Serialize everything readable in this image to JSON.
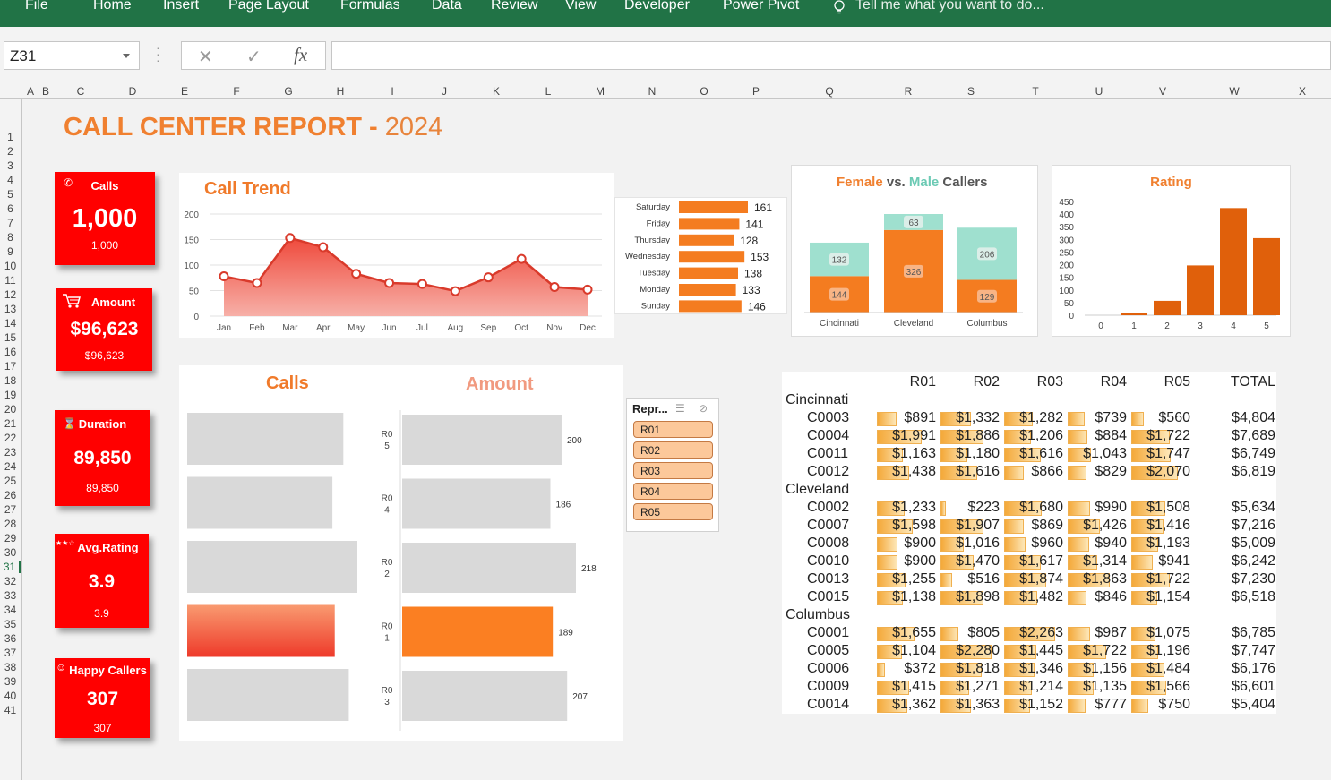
{
  "ribbon": {
    "tabs": [
      "File",
      "Home",
      "Insert",
      "Page Layout",
      "Formulas",
      "Data",
      "Review",
      "View",
      "Developer",
      "Power Pivot"
    ],
    "tell_me": "Tell me what you want to do..."
  },
  "formula_bar": {
    "name_box": "Z31",
    "fx": "fx",
    "cancel": "✕",
    "enter": "✓",
    "formula": ""
  },
  "columns": [
    "A",
    "B",
    "C",
    "D",
    "E",
    "F",
    "G",
    "H",
    "I",
    "J",
    "K",
    "L",
    "M",
    "N",
    "O",
    "P",
    "Q",
    "R",
    "S",
    "T",
    "U",
    "V",
    "W",
    "X"
  ],
  "rows": [
    "1",
    "2",
    "3",
    "4",
    "5",
    "6",
    "7",
    "8",
    "9",
    "10",
    "11",
    "12",
    "13",
    "14",
    "15",
    "16",
    "17",
    "18",
    "19",
    "20",
    "21",
    "22",
    "23",
    "24",
    "25",
    "26",
    "27",
    "28",
    "29",
    "30",
    "31",
    "32",
    "33",
    "34",
    "35",
    "36",
    "37",
    "38",
    "39",
    "40",
    "41"
  ],
  "report": {
    "title": "CALL CENTER REPORT - ",
    "year": "2024"
  },
  "kpis": [
    {
      "label": "Calls",
      "value": "1,000",
      "sub": "1,000",
      "icon": "phone-icon"
    },
    {
      "label": "Amount",
      "value": "$96,623",
      "sub": "$96,623",
      "icon": "cart-icon"
    },
    {
      "label": "Duration",
      "value": "89,850",
      "sub": "89,850",
      "icon": "hourglass-icon"
    },
    {
      "label": "Avg.Rating",
      "value": "3.9",
      "sub": "3.9",
      "icon": "stars-icon"
    },
    {
      "label": "Happy Callers",
      "value": "307",
      "sub": "307",
      "icon": "smiley-icon"
    }
  ],
  "colors": {
    "accent": "#f08030",
    "kpi_red": "#ff0000",
    "teal": "#9fe0cf",
    "ribbon": "#217346",
    "rating_bar": "#e0600b"
  },
  "trend_chart": {
    "title": "Call Trend",
    "chart_data": {
      "type": "area",
      "categories": [
        "Jan",
        "Feb",
        "Mar",
        "Apr",
        "May",
        "Jun",
        "Jul",
        "Aug",
        "Sep",
        "Oct",
        "Nov",
        "Dec"
      ],
      "values": [
        78,
        65,
        153,
        135,
        83,
        65,
        63,
        49,
        76,
        112,
        57,
        52
      ],
      "ylim": [
        0,
        200
      ],
      "yticks": [
        0,
        50,
        100,
        150,
        200
      ]
    }
  },
  "weekday_chart": {
    "chart_data": {
      "type": "bar",
      "categories": [
        "Saturday",
        "Friday",
        "Thursday",
        "Wednesday",
        "Tuesday",
        "Monday",
        "Sunday"
      ],
      "values": [
        161,
        141,
        128,
        153,
        138,
        133,
        146
      ]
    }
  },
  "gender_chart": {
    "title_female": "Female",
    "title_vs": " vs. ",
    "title_male": "Male",
    "title_callers": " Callers",
    "chart_data": {
      "type": "bar",
      "stacked": true,
      "categories": [
        "Cincinnati",
        "Cleveland",
        "Columbus"
      ],
      "series": [
        {
          "name": "Female",
          "values": [
            144,
            326,
            129
          ]
        },
        {
          "name": "Male",
          "values": [
            132,
            63,
            206
          ]
        }
      ]
    }
  },
  "rating_chart": {
    "title": "Rating",
    "chart_data": {
      "type": "bar",
      "categories": [
        "0",
        "1",
        "2",
        "3",
        "4",
        "5"
      ],
      "values": [
        0,
        9,
        57,
        197,
        424,
        305
      ],
      "ylim": [
        0,
        450
      ],
      "yticks": [
        0,
        50,
        100,
        150,
        200,
        250,
        300,
        350,
        400,
        450
      ]
    }
  },
  "rep_chart": {
    "calls_title": "Calls",
    "amount_title": "Amount",
    "reps": [
      "R0\n5",
      "R0\n4",
      "R0\n2",
      "R0\n1",
      "R0\n3"
    ],
    "chart_data": {
      "type": "bar",
      "categories": [
        "R05",
        "R04",
        "R02",
        "R01",
        "R03"
      ],
      "series": [
        {
          "name": "Calls",
          "values": [
            200,
            186,
            218,
            189,
            207
          ]
        },
        {
          "name": "Amount",
          "values": [
            200,
            186,
            218,
            189,
            207
          ]
        }
      ],
      "highlight": "R01"
    }
  },
  "slicer": {
    "header": "Repr...",
    "items": [
      "R01",
      "R02",
      "R03",
      "R04",
      "R05"
    ]
  },
  "pivot": {
    "headers": [
      "R01",
      "R02",
      "R03",
      "R04",
      "R05",
      "TOTAL"
    ],
    "groups": [
      {
        "city": "Cincinnati",
        "rows": [
          {
            "id": "C0003",
            "v": [
              "$891",
              "$1,332",
              "$1,282",
              "$739",
              "$560"
            ],
            "n": [
              891,
              1332,
              1282,
              739,
              560
            ],
            "t": "$4,804"
          },
          {
            "id": "C0004",
            "v": [
              "$1,991",
              "$1,886",
              "$1,206",
              "$884",
              "$1,722"
            ],
            "n": [
              1991,
              1886,
              1206,
              884,
              1722
            ],
            "t": "$7,689"
          },
          {
            "id": "C0011",
            "v": [
              "$1,163",
              "$1,180",
              "$1,616",
              "$1,043",
              "$1,747"
            ],
            "n": [
              1163,
              1180,
              1616,
              1043,
              1747
            ],
            "t": "$6,749"
          },
          {
            "id": "C0012",
            "v": [
              "$1,438",
              "$1,616",
              "$866",
              "$829",
              "$2,070"
            ],
            "n": [
              1438,
              1616,
              866,
              829,
              2070
            ],
            "t": "$6,819"
          }
        ]
      },
      {
        "city": "Cleveland",
        "rows": [
          {
            "id": "C0002",
            "v": [
              "$1,233",
              "$223",
              "$1,680",
              "$990",
              "$1,508"
            ],
            "n": [
              1233,
              223,
              1680,
              990,
              1508
            ],
            "t": "$5,634"
          },
          {
            "id": "C0007",
            "v": [
              "$1,598",
              "$1,907",
              "$869",
              "$1,426",
              "$1,416"
            ],
            "n": [
              1598,
              1907,
              869,
              1426,
              1416
            ],
            "t": "$7,216"
          },
          {
            "id": "C0008",
            "v": [
              "$900",
              "$1,016",
              "$960",
              "$940",
              "$1,193"
            ],
            "n": [
              900,
              1016,
              960,
              940,
              1193
            ],
            "t": "$5,009"
          },
          {
            "id": "C0010",
            "v": [
              "$900",
              "$1,470",
              "$1,617",
              "$1,314",
              "$941"
            ],
            "n": [
              900,
              1470,
              1617,
              1314,
              941
            ],
            "t": "$6,242"
          },
          {
            "id": "C0013",
            "v": [
              "$1,255",
              "$516",
              "$1,874",
              "$1,863",
              "$1,722"
            ],
            "n": [
              1255,
              516,
              1874,
              1863,
              1722
            ],
            "t": "$7,230"
          },
          {
            "id": "C0015",
            "v": [
              "$1,138",
              "$1,898",
              "$1,482",
              "$846",
              "$1,154"
            ],
            "n": [
              1138,
              1898,
              1482,
              846,
              1154
            ],
            "t": "$6,518"
          }
        ]
      },
      {
        "city": "Columbus",
        "rows": [
          {
            "id": "C0001",
            "v": [
              "$1,655",
              "$805",
              "$2,263",
              "$987",
              "$1,075"
            ],
            "n": [
              1655,
              805,
              2263,
              987,
              1075
            ],
            "t": "$6,785"
          },
          {
            "id": "C0005",
            "v": [
              "$1,104",
              "$2,280",
              "$1,445",
              "$1,722",
              "$1,196"
            ],
            "n": [
              1104,
              2280,
              1445,
              1722,
              1196
            ],
            "t": "$7,747"
          },
          {
            "id": "C0006",
            "v": [
              "$372",
              "$1,818",
              "$1,346",
              "$1,156",
              "$1,484"
            ],
            "n": [
              372,
              1818,
              1346,
              1156,
              1484
            ],
            "t": "$6,176"
          },
          {
            "id": "C0009",
            "v": [
              "$1,415",
              "$1,271",
              "$1,214",
              "$1,135",
              "$1,566"
            ],
            "n": [
              1415,
              1271,
              1214,
              1135,
              1566
            ],
            "t": "$6,601"
          },
          {
            "id": "C0014",
            "v": [
              "$1,362",
              "$1,363",
              "$1,152",
              "$777",
              "$750"
            ],
            "n": [
              1362,
              1363,
              1152,
              777,
              750
            ],
            "t": "$5,404"
          }
        ]
      }
    ]
  }
}
